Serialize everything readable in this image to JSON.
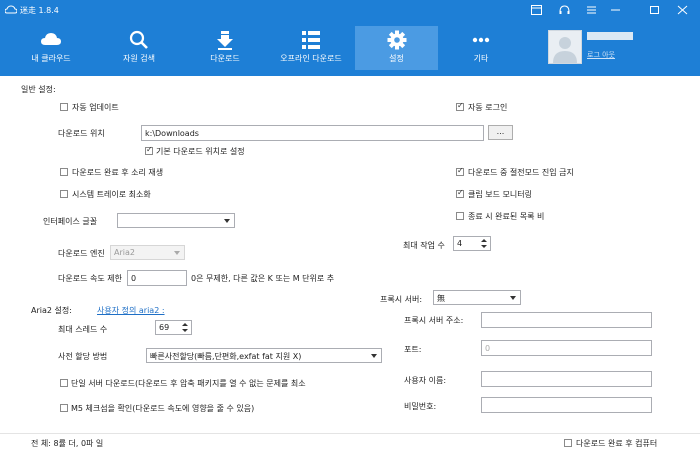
{
  "app": {
    "title": "迷走 1.8.4"
  },
  "nav": {
    "tabs": [
      {
        "label": "내 클라우드",
        "icon": "cloud-icon"
      },
      {
        "label": "자원 검색",
        "icon": "search-icon"
      },
      {
        "label": "다운로드",
        "icon": "download-icon"
      },
      {
        "label": "오프라인 다운로드",
        "icon": "list-icon"
      },
      {
        "label": "설정",
        "icon": "gear-icon",
        "active": true
      },
      {
        "label": "기타",
        "icon": "more-icon"
      }
    ]
  },
  "user": {
    "logout": "로그 아웃"
  },
  "general": {
    "heading": "일반 설정:",
    "auto_update": {
      "label": "자동 업데이트",
      "checked": false
    },
    "auto_login": {
      "label": "자동 로그인",
      "checked": true
    },
    "download_location": {
      "label": "다운로드 위치",
      "value": "k:\\Downloads",
      "browse": "..."
    },
    "default_location": {
      "label": "기본 다운로드 위치로 설정",
      "checked": true
    },
    "sound_after": {
      "label": "다운로드 완료 후 소리 재생",
      "checked": false
    },
    "no_power_save": {
      "label": "다운로드 중 절전모드 진입 금지",
      "checked": true
    },
    "minimize_tray": {
      "label": "시스템 트레이로 최소화",
      "checked": false
    },
    "clipboard": {
      "label": "클립 보드 모니터링",
      "checked": true
    },
    "clear_list": {
      "label": "종료 시 완료된 목록 비",
      "checked": false
    },
    "interface_font": {
      "label": "인터페이스 글꼴",
      "value": ""
    },
    "max_tasks": {
      "label": "최대 작업 수",
      "value": "4"
    },
    "engine": {
      "label": "다운로드 엔진",
      "value": "Aria2"
    },
    "speed_limit": {
      "label": "다운로드 속도 제한",
      "value": "0",
      "hint": "0은 무제한, 다른 값은 K 또는 M 단위로 추"
    }
  },
  "aria2": {
    "heading": "Aria2 설정:",
    "custom_link": "사용자 정의 aria2 :",
    "max_threads": {
      "label": "최대 스레드 수",
      "value": "69"
    },
    "prealloc": {
      "label": "사전 할당 방법",
      "value": "빠른사전할당(빠름,단편화,exfat fat 지원 X)"
    },
    "single_server": {
      "label": "단일 서버 다운로드(다운로드 후 압축 패키지를 열 수 없는 문제를 최소",
      "checked": false
    },
    "md5": {
      "label": "M5 체크섬을 확인(다운로드 속도에 영향을 줄 수 있음)",
      "checked": false
    }
  },
  "proxy": {
    "server_label": "프록시 서버:",
    "server_value": "無",
    "address_label": "프록시 서버 주소:",
    "address_value": "",
    "port_label": "포트:",
    "port_placeholder": "0",
    "username_label": "사용자 이름:",
    "password_label": "비밀번호:"
  },
  "status": {
    "summary": "전 체: 8률 더, 0파 일",
    "shutdown": {
      "label": "다운로드 완료 후 컴퓨터",
      "checked": false
    }
  }
}
